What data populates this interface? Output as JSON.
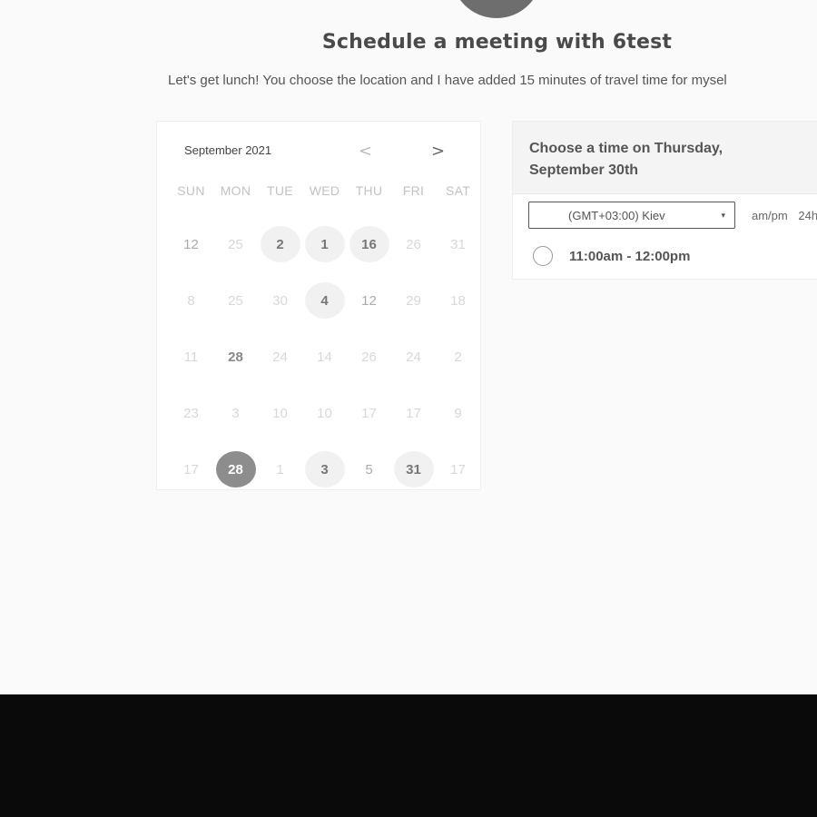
{
  "header": {
    "title": "Schedule a meeting with 6test",
    "subtitle": "Let's get lunch! You choose the location and I have added 15 minutes of travel time for mysel"
  },
  "calendar": {
    "month_label": "September 2021",
    "prev_icon": "chevron-left-icon",
    "next_icon": "chevron-right-icon",
    "prev_glyph": "<",
    "next_glyph": ">",
    "weekdays": [
      "SUN",
      "MON",
      "TUE",
      "WED",
      "THU",
      "FRI",
      "SAT"
    ],
    "days": [
      {
        "label": "12",
        "state": "avail"
      },
      {
        "label": "25",
        "state": "off"
      },
      {
        "label": "2",
        "state": "hl"
      },
      {
        "label": "1",
        "state": "hl"
      },
      {
        "label": "16",
        "state": "hl"
      },
      {
        "label": "26",
        "state": "off"
      },
      {
        "label": "31",
        "state": "off"
      },
      {
        "label": "8",
        "state": "off"
      },
      {
        "label": "25",
        "state": "off"
      },
      {
        "label": "30",
        "state": "off"
      },
      {
        "label": "4",
        "state": "hl"
      },
      {
        "label": "12",
        "state": "avail"
      },
      {
        "label": "29",
        "state": "off"
      },
      {
        "label": "18",
        "state": "off"
      },
      {
        "label": "11",
        "state": "off"
      },
      {
        "label": "28",
        "state": "bold"
      },
      {
        "label": "24",
        "state": "off"
      },
      {
        "label": "14",
        "state": "off"
      },
      {
        "label": "26",
        "state": "off"
      },
      {
        "label": "24",
        "state": "off"
      },
      {
        "label": "2",
        "state": "off"
      },
      {
        "label": "23",
        "state": "off"
      },
      {
        "label": "3",
        "state": "off"
      },
      {
        "label": "10",
        "state": "off"
      },
      {
        "label": "10",
        "state": "off"
      },
      {
        "label": "17",
        "state": "off"
      },
      {
        "label": "17",
        "state": "off"
      },
      {
        "label": "9",
        "state": "off"
      },
      {
        "label": "17",
        "state": "off"
      },
      {
        "label": "28",
        "state": "sel"
      },
      {
        "label": "1",
        "state": "off"
      },
      {
        "label": "3",
        "state": "hl"
      },
      {
        "label": "5",
        "state": "avail"
      },
      {
        "label": "31",
        "state": "hl"
      },
      {
        "label": "17",
        "state": "off"
      }
    ]
  },
  "time_panel": {
    "heading_line1": "Choose a time on Thursday,",
    "heading_line2": "September 30th",
    "timezone_value": "(GMT+03:00) Kiev",
    "timezone_caret": "▾",
    "format_ampm": "am/pm",
    "format_24h": "24h",
    "slots": [
      {
        "label": "11:00am - 12:00pm"
      }
    ]
  },
  "colors": {
    "selected_day": "#8d8d8d",
    "highlight_day": "#f1f1f1",
    "bottom_band": "#0a0a0a"
  }
}
